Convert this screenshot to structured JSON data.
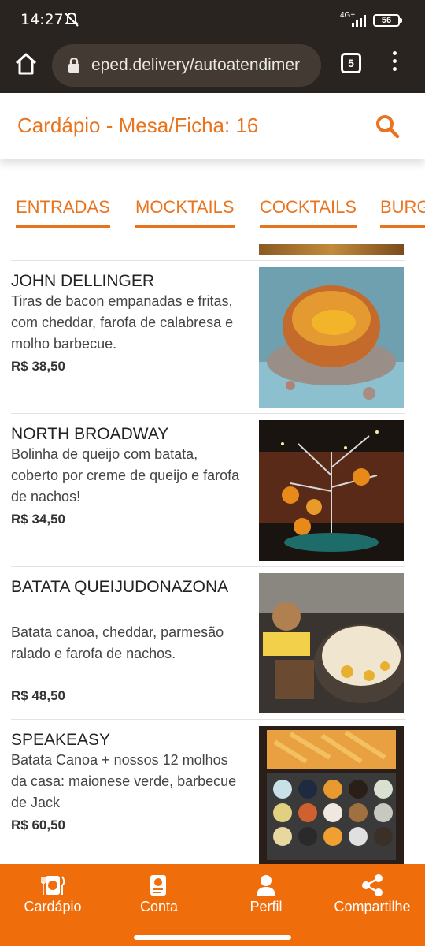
{
  "status_bar": {
    "time": "14:27",
    "network": "4G+",
    "battery": "56"
  },
  "browser": {
    "url": "eped.delivery/autoatendimer",
    "tab_count": "5"
  },
  "header": {
    "title": "Cardápio - Mesa/Ficha: 16"
  },
  "categories": [
    "ENTRADAS",
    "MOCKTAILS",
    "COCKTAILS",
    "BURG"
  ],
  "products": [
    {
      "name": "JOHN DELLINGER",
      "description": "Tiras de bacon empanadas e fritas, com cheddar, farofa de calabresa e molho barbecue.",
      "price": "R$ 38,50"
    },
    {
      "name": "NORTH BROADWAY",
      "description": "Bolinha de queijo com batata, coberto por creme de queijo e farofa de nachos!",
      "price": "R$ 34,50"
    },
    {
      "name": "BATATA QUEIJUDONAZONA",
      "description": "Batata canoa, cheddar, parmesão ralado e farofa de nachos.",
      "price": "R$ 48,50"
    },
    {
      "name": "SPEAKEASY",
      "description": "Batata Canoa + nossos 12 molhos da casa: maionese verde, barbecue de Jack",
      "price": "R$ 60,50"
    }
  ],
  "bottom_nav": [
    {
      "label": "Cardápio",
      "icon": "menu-cutlery-icon"
    },
    {
      "label": "Conta",
      "icon": "bill-icon"
    },
    {
      "label": "Perfil",
      "icon": "user-icon"
    },
    {
      "label": "Compartilhe",
      "icon": "share-icon"
    }
  ],
  "colors": {
    "accent": "#e8741f",
    "nav_background": "#f06d0c",
    "browser_chrome": "#2a2420"
  }
}
